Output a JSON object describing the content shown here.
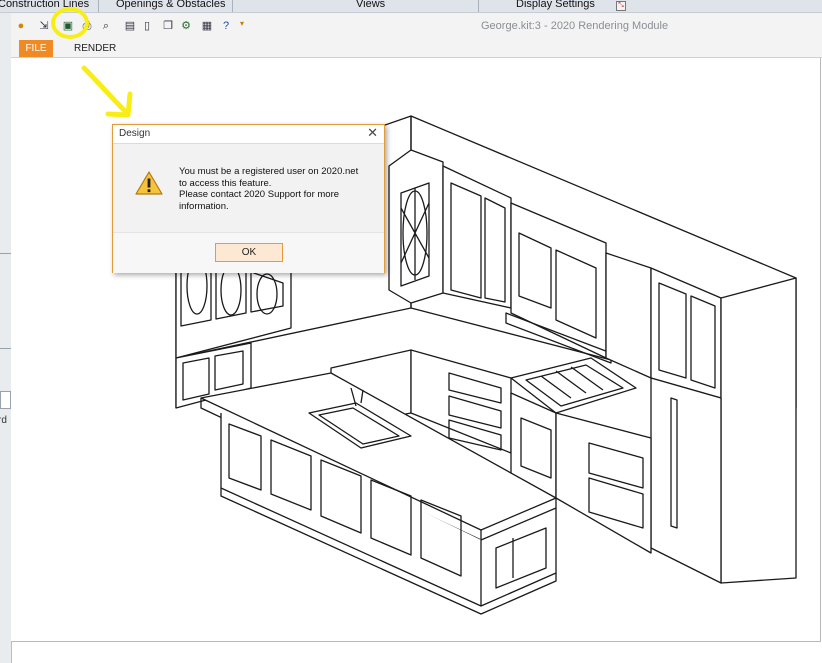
{
  "top_tabs": [
    {
      "label": "Construction Lines",
      "x_hint": "left"
    },
    {
      "label": "Openings & Obstacles"
    },
    {
      "label": "Views"
    },
    {
      "label": "Display Settings"
    }
  ],
  "left_panel": {
    "fragment_label": "rd"
  },
  "window_title": "George.kit:3 - 2020 Rendering Module",
  "ribbon_tabs": {
    "file": "FILE",
    "render": "RENDER"
  },
  "toolbar_icons": [
    "app-menu-icon",
    "export-icon",
    "dropdown-icon",
    "print-setup-icon",
    "print-icon",
    "zoom-icon",
    "preview-icon",
    "page-icon",
    "copy-icon",
    "settings-icon",
    "film-icon",
    "help-icon",
    "overflow-icon"
  ],
  "dialog": {
    "title": "Design",
    "close_glyph": "✕",
    "message_lines": [
      "You must be a registered user on 2020.net",
      "to access this feature.",
      "Please contact 2020 Support for more",
      "information."
    ],
    "ok_label": "OK",
    "icon": "warning-icon"
  },
  "colors": {
    "accent_orange": "#f08a24",
    "highlight_yellow": "#f8ee16",
    "dialog_border": "#e39a3a"
  }
}
